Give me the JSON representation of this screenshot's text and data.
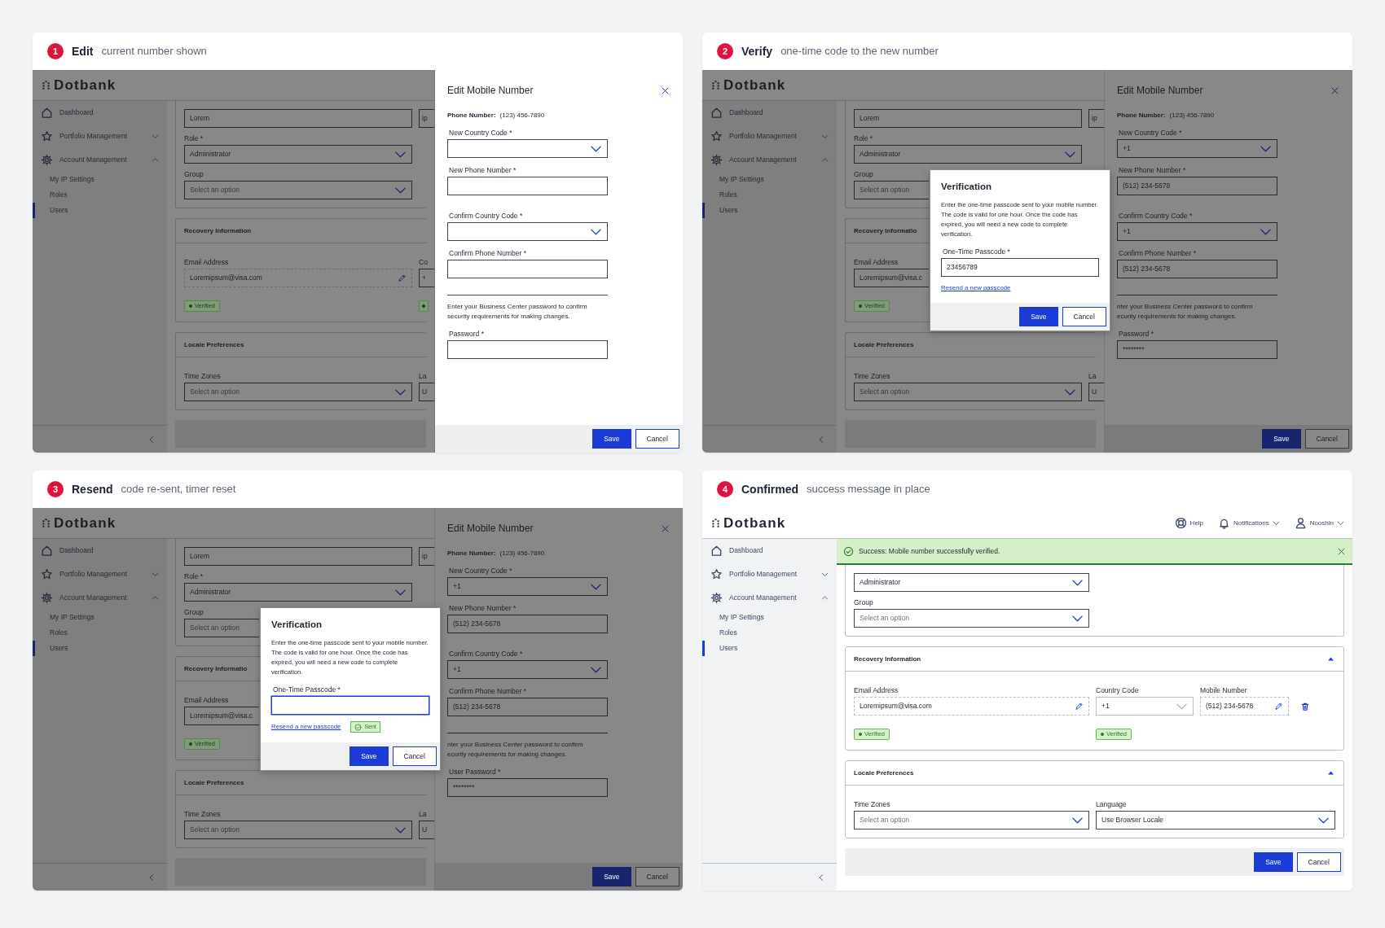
{
  "panels": [
    {
      "step": "1",
      "title": "Edit",
      "subtitle": "current number shown",
      "screen": {
        "app": {
          "dimmed": true,
          "logo": "Dotbank",
          "sidebar": [
            {
              "label": "Dashboard"
            },
            {
              "label": "Portfolio Management",
              "expanded": false
            },
            {
              "label": "Account Management",
              "expanded": true,
              "children": [
                {
                  "label": "My IP Settings",
                  "selected": false
                },
                {
                  "label": "Roles",
                  "selected": false
                },
                {
                  "label": "Users",
                  "selected": true
                }
              ]
            }
          ],
          "sections": [
            {
              "rows": [
                [
                  {
                    "kind": "input",
                    "value": "Lorem"
                  },
                  {
                    "kind": "input_fragment",
                    "text": "ip"
                  }
                ],
                [
                  {
                    "kind": "label",
                    "text": "Role *"
                  }
                ],
                [
                  {
                    "kind": "select",
                    "value": "Administrator"
                  }
                ],
                [
                  {
                    "kind": "label",
                    "text": "Group"
                  }
                ],
                [
                  {
                    "kind": "select",
                    "placeholder": "Select an option"
                  }
                ]
              ]
            },
            {
              "title": "Recovery Information",
              "rows": [
                [
                  {
                    "kind": "label",
                    "text": "Email Address"
                  },
                  {
                    "kind": "label_fragment",
                    "text": "Co"
                  }
                ],
                [
                  {
                    "kind": "input",
                    "value": "Loremipsum@visa.com",
                    "editable": true
                  },
                  {
                    "kind": "input_fragment",
                    "text": "+"
                  }
                ],
                [
                  {
                    "kind": "badge",
                    "text": "Verified"
                  },
                  {
                    "kind": "badge_fragment"
                  }
                ]
              ]
            },
            {
              "title": "Locale Preferences",
              "rows": [
                [
                  {
                    "kind": "label",
                    "text": "Time Zones"
                  },
                  {
                    "kind": "label_fragment",
                    "text": "La"
                  }
                ],
                [
                  {
                    "kind": "select",
                    "placeholder": "Select an option"
                  },
                  {
                    "kind": "input_fragment",
                    "text": "U"
                  }
                ]
              ]
            }
          ]
        },
        "drawer": {
          "dimmed": false,
          "title": "Edit Mobile Number",
          "phone_label": "Phone Number:",
          "phone_value": "(123) 456-7890",
          "fields": [
            {
              "kind": "select",
              "label": "New Country Code *"
            },
            {
              "kind": "input",
              "label": "New Phone Number *"
            },
            {
              "kind": "select",
              "label": "Confirm Country Code *"
            },
            {
              "kind": "input",
              "label": "Confirm Phone Number *"
            },
            {
              "kind": "note",
              "lines": [
                "Enter your Business Center password to confirm",
                "security requirements for making changes."
              ]
            },
            {
              "kind": "password",
              "label": "Password *"
            }
          ],
          "buttons": [
            {
              "kind": "primary",
              "label": "Save"
            },
            {
              "kind": "secondary",
              "label": "Cancel"
            }
          ]
        }
      }
    },
    {
      "step": "2",
      "title": "Verify",
      "subtitle": "one-time code to the new number",
      "screen": {
        "app": {
          "dimmed": true,
          "logo": "Dotbank",
          "sidebar": [
            {
              "label": "Dashboard"
            },
            {
              "label": "Portfolio Management",
              "expanded": false
            },
            {
              "label": "Account Management",
              "expanded": true,
              "children": [
                {
                  "label": "My IP Settings",
                  "selected": false
                },
                {
                  "label": "Roles",
                  "selected": false
                },
                {
                  "label": "Users",
                  "selected": true
                }
              ]
            }
          ],
          "sections": [
            {
              "rows": [
                [
                  {
                    "kind": "input",
                    "value": "Lorem"
                  },
                  {
                    "kind": "input_fragment",
                    "text": "ip"
                  }
                ],
                [
                  {
                    "kind": "label",
                    "text": "Role *"
                  }
                ],
                [
                  {
                    "kind": "select",
                    "value": "Administrator"
                  }
                ],
                [
                  {
                    "kind": "label",
                    "text": "Group"
                  }
                ],
                [
                  {
                    "kind": "select",
                    "placeholder": "Select an option",
                    "covered": true
                  }
                ]
              ]
            },
            {
              "title": "Recovery Informatio",
              "rows": [
                [
                  {
                    "kind": "label",
                    "text": "Email Address"
                  }
                ],
                [
                  {
                    "kind": "input",
                    "value": "Loremipsum@visa.c",
                    "covered": true
                  }
                ],
                [
                  {
                    "kind": "badge",
                    "text": "Verified"
                  }
                ]
              ]
            },
            {
              "title": "Locale Preferences",
              "rows": [
                [
                  {
                    "kind": "label",
                    "text": "Time Zones"
                  },
                  {
                    "kind": "label_fragment",
                    "text": "La"
                  }
                ],
                [
                  {
                    "kind": "select",
                    "placeholder": "Select an option"
                  },
                  {
                    "kind": "input_fragment",
                    "text": "U"
                  }
                ]
              ]
            }
          ]
        },
        "drawer": {
          "dimmed": true,
          "title": "Edit Mobile Number",
          "phone_label": "Phone Number:",
          "phone_value": "(123) 456-7890",
          "fields": [
            {
              "kind": "select",
              "label": "New Country Code *",
              "value": "+1"
            },
            {
              "kind": "input",
              "label": "New Phone Number *",
              "value": "(512) 234-5678"
            },
            {
              "kind": "select",
              "label": "Confirm Country Code *",
              "value": "+1"
            },
            {
              "kind": "input",
              "label": "Confirm Phone Number *",
              "value": "(512) 234-5678"
            },
            {
              "kind": "note",
              "lines": [
                "nter your Business Center password to confirm",
                "ecurity requirements for making changes."
              ]
            },
            {
              "kind": "password",
              "label": "Password *",
              "value": "********"
            }
          ],
          "buttons": [
            {
              "kind": "primary",
              "label": "Save"
            },
            {
              "kind": "secondary",
              "label": "Cancel"
            }
          ]
        },
        "modal": {
          "title": "Verification",
          "message": "Enter the one-time passcode sent to your mobile number. The code is valid for one hour. Once the code has expired, you will need a new code to complete verification.",
          "field_label": "One-Time Passcode *",
          "value": "23456789",
          "focused": false,
          "link": "Resend a new passcode",
          "buttons": [
            {
              "kind": "primary",
              "label": "Save"
            },
            {
              "kind": "secondary",
              "label": "Cancel"
            }
          ]
        }
      }
    },
    {
      "step": "3",
      "title": "Resend",
      "subtitle": "code re-sent, timer reset",
      "screen": {
        "app": {
          "dimmed": true,
          "logo": "Dotbank",
          "sidebar": [
            {
              "label": "Dashboard"
            },
            {
              "label": "Portfolio Management",
              "expanded": false
            },
            {
              "label": "Account Management",
              "expanded": true,
              "children": [
                {
                  "label": "My IP Settings",
                  "selected": false
                },
                {
                  "label": "Roles",
                  "selected": false
                },
                {
                  "label": "Users",
                  "selected": true
                }
              ]
            }
          ],
          "sections": [
            {
              "rows": [
                [
                  {
                    "kind": "input",
                    "value": "Lorem"
                  },
                  {
                    "kind": "input_fragment",
                    "text": "ip"
                  }
                ],
                [
                  {
                    "kind": "label",
                    "text": "Role *"
                  }
                ],
                [
                  {
                    "kind": "select",
                    "value": "Administrator"
                  }
                ],
                [
                  {
                    "kind": "label",
                    "text": "Group"
                  }
                ],
                [
                  {
                    "kind": "select",
                    "placeholder": "Select an option",
                    "covered": true
                  }
                ]
              ]
            },
            {
              "title": "Recovery Informatio",
              "rows": [
                [
                  {
                    "kind": "label",
                    "text": "Email Address"
                  }
                ],
                [
                  {
                    "kind": "input",
                    "value": "Loremipsum@visa.c",
                    "covered": true
                  }
                ],
                [
                  {
                    "kind": "badge",
                    "text": "Verified"
                  }
                ]
              ]
            },
            {
              "title": "Locale Preferences",
              "rows": [
                [
                  {
                    "kind": "label",
                    "text": "Time Zones"
                  },
                  {
                    "kind": "label_fragment",
                    "text": "La"
                  }
                ],
                [
                  {
                    "kind": "select",
                    "placeholder": "Select an option"
                  },
                  {
                    "kind": "input_fragment",
                    "text": "U"
                  }
                ]
              ]
            }
          ]
        },
        "drawer": {
          "dimmed": true,
          "title": "Edit Mobile Number",
          "phone_label": "Phone Number:",
          "phone_value": "(123) 456-7890",
          "fields": [
            {
              "kind": "select",
              "label": "New Country Code *",
              "value": "+1"
            },
            {
              "kind": "input",
              "label": "New Phone Number *",
              "value": "(512) 234-5678"
            },
            {
              "kind": "select",
              "label": "Confirm Country Code *",
              "value": "+1"
            },
            {
              "kind": "input",
              "label": "Confirm Phone Number *",
              "value": "(512) 234-5678"
            },
            {
              "kind": "note",
              "lines": [
                "nter your Business Center password to confirm",
                "ecurity requirements for making changes."
              ]
            },
            {
              "kind": "password",
              "label": "User Password *",
              "value": "********"
            }
          ],
          "buttons": [
            {
              "kind": "primary",
              "label": "Save"
            },
            {
              "kind": "secondary",
              "label": "Cancel"
            }
          ]
        },
        "modal": {
          "title": "Verification",
          "message": "Enter the one-time passcode sent to your mobile number. The code is valid for one hour. Once the code has expired, you will need a new code to complete verification.",
          "field_label": "One-Time Passcode *",
          "focused": true,
          "link": "Resend a new passcode",
          "sent_badge": "Sent",
          "buttons": [
            {
              "kind": "primary",
              "label": "Save"
            },
            {
              "kind": "secondary",
              "label": "Cancel"
            }
          ]
        }
      }
    },
    {
      "step": "4",
      "title": "Confirmed",
      "subtitle": "success message in place",
      "screen": {
        "app": {
          "dimmed": false,
          "logo": "Dotbank",
          "header_actions": [
            {
              "label": "Help",
              "menu": false
            },
            {
              "label": "Notifications",
              "menu": true
            },
            {
              "label": "Nooshin",
              "menu": true
            }
          ],
          "sidebar": [
            {
              "label": "Dashboard"
            },
            {
              "label": "Portfolio Management",
              "expanded": false
            },
            {
              "label": "Account Management",
              "expanded": true,
              "children": [
                {
                  "label": "My IP Settings",
                  "selected": false
                },
                {
                  "label": "Roles",
                  "selected": false
                },
                {
                  "label": "Users",
                  "selected": true
                }
              ]
            }
          ],
          "alert": {
            "kind": "success",
            "text": "Success: Mobile number successfully verified."
          },
          "sections": [
            {
              "rows": [
                [
                  {
                    "kind": "select",
                    "value": "Administrator"
                  }
                ],
                [
                  {
                    "kind": "label",
                    "text": "Group"
                  }
                ],
                [
                  {
                    "kind": "select",
                    "placeholder": "Select an option"
                  }
                ]
              ]
            },
            {
              "title": "Recovery Information",
              "expanded": true,
              "rows": [
                [
                  {
                    "kind": "label",
                    "text": "Email Address"
                  },
                  {
                    "kind": "label",
                    "text": "Country Code"
                  },
                  {
                    "kind": "label",
                    "text": "Mobile Number"
                  }
                ],
                [
                  {
                    "kind": "input",
                    "value": "Loremipsum@visa.com",
                    "editable": true
                  },
                  {
                    "kind": "select",
                    "value": "+1",
                    "disabled": true
                  },
                  {
                    "kind": "input",
                    "value": "(512) 234-5678",
                    "editable": true
                  },
                  {
                    "kind": "icon_button"
                  }
                ],
                [
                  {
                    "kind": "badge",
                    "text": "Verified"
                  },
                  {
                    "kind": "badge",
                    "text": "Verified"
                  }
                ]
              ]
            },
            {
              "title": "Locale Preferences",
              "expanded": true,
              "rows": [
                [
                  {
                    "kind": "label",
                    "text": "Time Zones"
                  },
                  {
                    "kind": "label",
                    "text": "Language"
                  }
                ],
                [
                  {
                    "kind": "select",
                    "placeholder": "Select an option"
                  },
                  {
                    "kind": "select",
                    "value": "Use Browser Locale"
                  }
                ]
              ]
            }
          ],
          "footer_buttons": [
            {
              "kind": "primary",
              "label": "Save"
            },
            {
              "kind": "secondary",
              "label": "Cancel"
            }
          ]
        }
      }
    }
  ]
}
